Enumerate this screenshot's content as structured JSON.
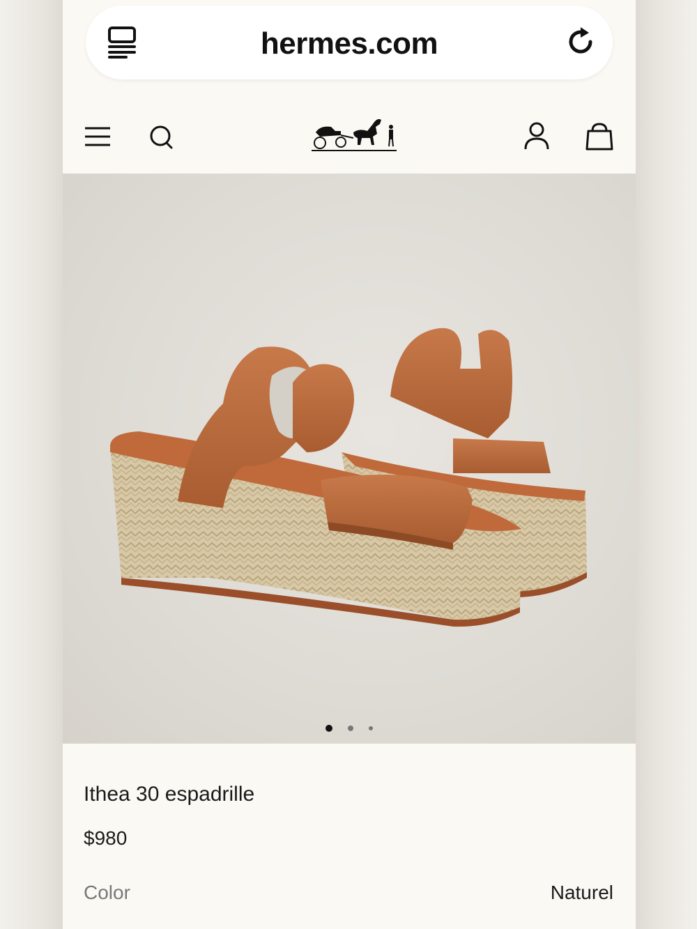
{
  "browser": {
    "url": "hermes.com",
    "icons": {
      "tabs": "tabs-icon",
      "reload": "reload-icon"
    }
  },
  "nav": {
    "icons": {
      "menu": "hamburger-menu-icon",
      "search": "search-icon",
      "logo": "hermes-carriage-logo",
      "account": "account-icon",
      "bag": "shopping-bag-icon"
    }
  },
  "carousel": {
    "total": 3,
    "active": 1
  },
  "product": {
    "name": "Ithea 30 espadrille",
    "price": "$980",
    "color_label": "Color",
    "color_value": "Naturel"
  },
  "colors": {
    "page_bg": "#fbf9f4",
    "leather": "#b8693a",
    "raffia": "#d8c8a6"
  }
}
